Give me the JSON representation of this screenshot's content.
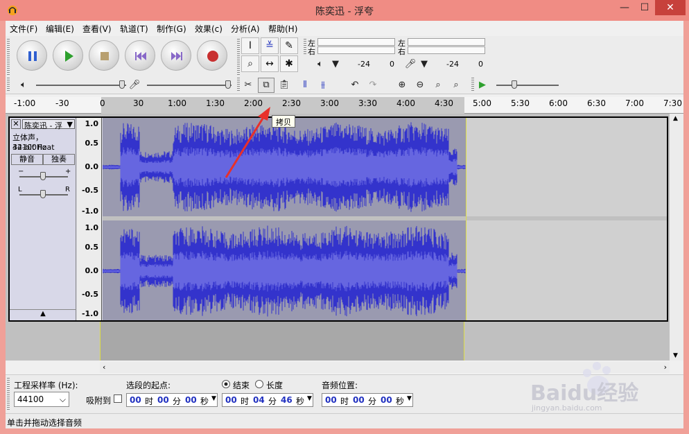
{
  "window": {
    "title": "陈奕迅 - 浮夸",
    "minimize": "—",
    "maximize": "☐",
    "close": "✕"
  },
  "menu": [
    "文件(F)",
    "编辑(E)",
    "查看(V)",
    "轨道(T)",
    "制作(G)",
    "效果(c)",
    "分析(A)",
    "帮助(H)"
  ],
  "meter": {
    "left_label": "左",
    "right_label": "右",
    "play_db": "-24",
    "play_zero": "0",
    "rec_db": "-24",
    "rec_zero": "0"
  },
  "ruler": {
    "ticks": [
      "-1:00",
      "-30",
      "0",
      "30",
      "1:00",
      "1:30",
      "2:00",
      "2:30",
      "3:00",
      "3:30",
      "4:00",
      "4:30",
      "5:00",
      "5:30",
      "6:00",
      "6:30",
      "7:00",
      "7:30"
    ]
  },
  "tooltip": "拷贝",
  "track": {
    "name": "陈奕迅 - 浮",
    "info_line1": "立体声，44100Hz",
    "info_line2": "32-bit float",
    "mute": "静音",
    "solo": "独奏",
    "collapse": "▲",
    "scale_top": [
      "1.0",
      "0.5",
      "0.0",
      "-0.5",
      "-1.0"
    ],
    "scale_bottom": [
      "1.0",
      "0.5",
      "0.0",
      "-0.5",
      "-1.0"
    ]
  },
  "selection_bar": {
    "rate_label": "工程采样率 (Hz):",
    "rate_value": "44100",
    "snap_label": "吸附到",
    "start_label": "选段的起点:",
    "end_radio": "结束",
    "length_radio": "长度",
    "audio_pos_label": "音频位置:",
    "start_time": {
      "h": "00",
      "m": "00",
      "s": "00"
    },
    "end_time": {
      "h": "00",
      "m": "04",
      "s": "46"
    },
    "pos_time": {
      "h": "00",
      "m": "00",
      "s": "00"
    },
    "unit_h": "时",
    "unit_m": "分",
    "unit_s": "秒"
  },
  "status": "单击并拖动选择音频",
  "watermark": {
    "brand": "Baidu经验",
    "url": "jingyan.baidu.com"
  },
  "colors": {
    "titlebar": "#f08c84",
    "waveform": "#3333cc",
    "waveform_rms": "#6666e0",
    "selection": "#c8c8c8",
    "close": "#c7413b"
  }
}
